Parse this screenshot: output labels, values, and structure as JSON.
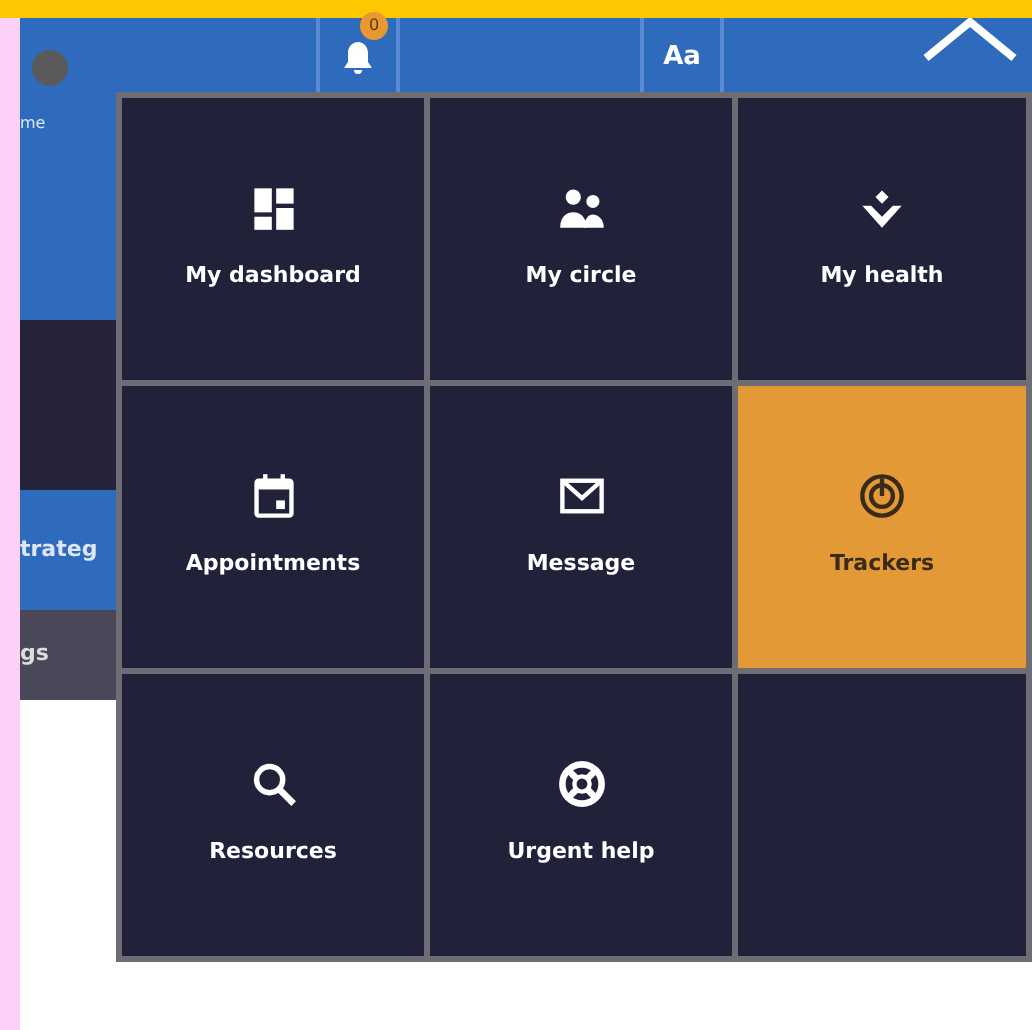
{
  "header": {
    "notification_count": "0",
    "text_size_label": "Aa"
  },
  "background": {
    "nav_label": "me",
    "items": [
      {
        "label": "trateg",
        "selected": true
      },
      {
        "label": "gs",
        "selected": false
      }
    ]
  },
  "menu": {
    "items": [
      {
        "label": "My dashboard",
        "kind": "dashboard",
        "selected": false
      },
      {
        "label": "My circle",
        "kind": "people",
        "selected": false
      },
      {
        "label": "My health",
        "kind": "health",
        "selected": false
      },
      {
        "label": "Appointments",
        "kind": "calendar",
        "selected": false
      },
      {
        "label": "Message",
        "kind": "envelope",
        "selected": false
      },
      {
        "label": "Trackers",
        "kind": "tracker",
        "selected": true
      },
      {
        "label": "Resources",
        "kind": "search",
        "selected": false
      },
      {
        "label": "Urgent help",
        "kind": "lifebuoy",
        "selected": false
      }
    ]
  }
}
